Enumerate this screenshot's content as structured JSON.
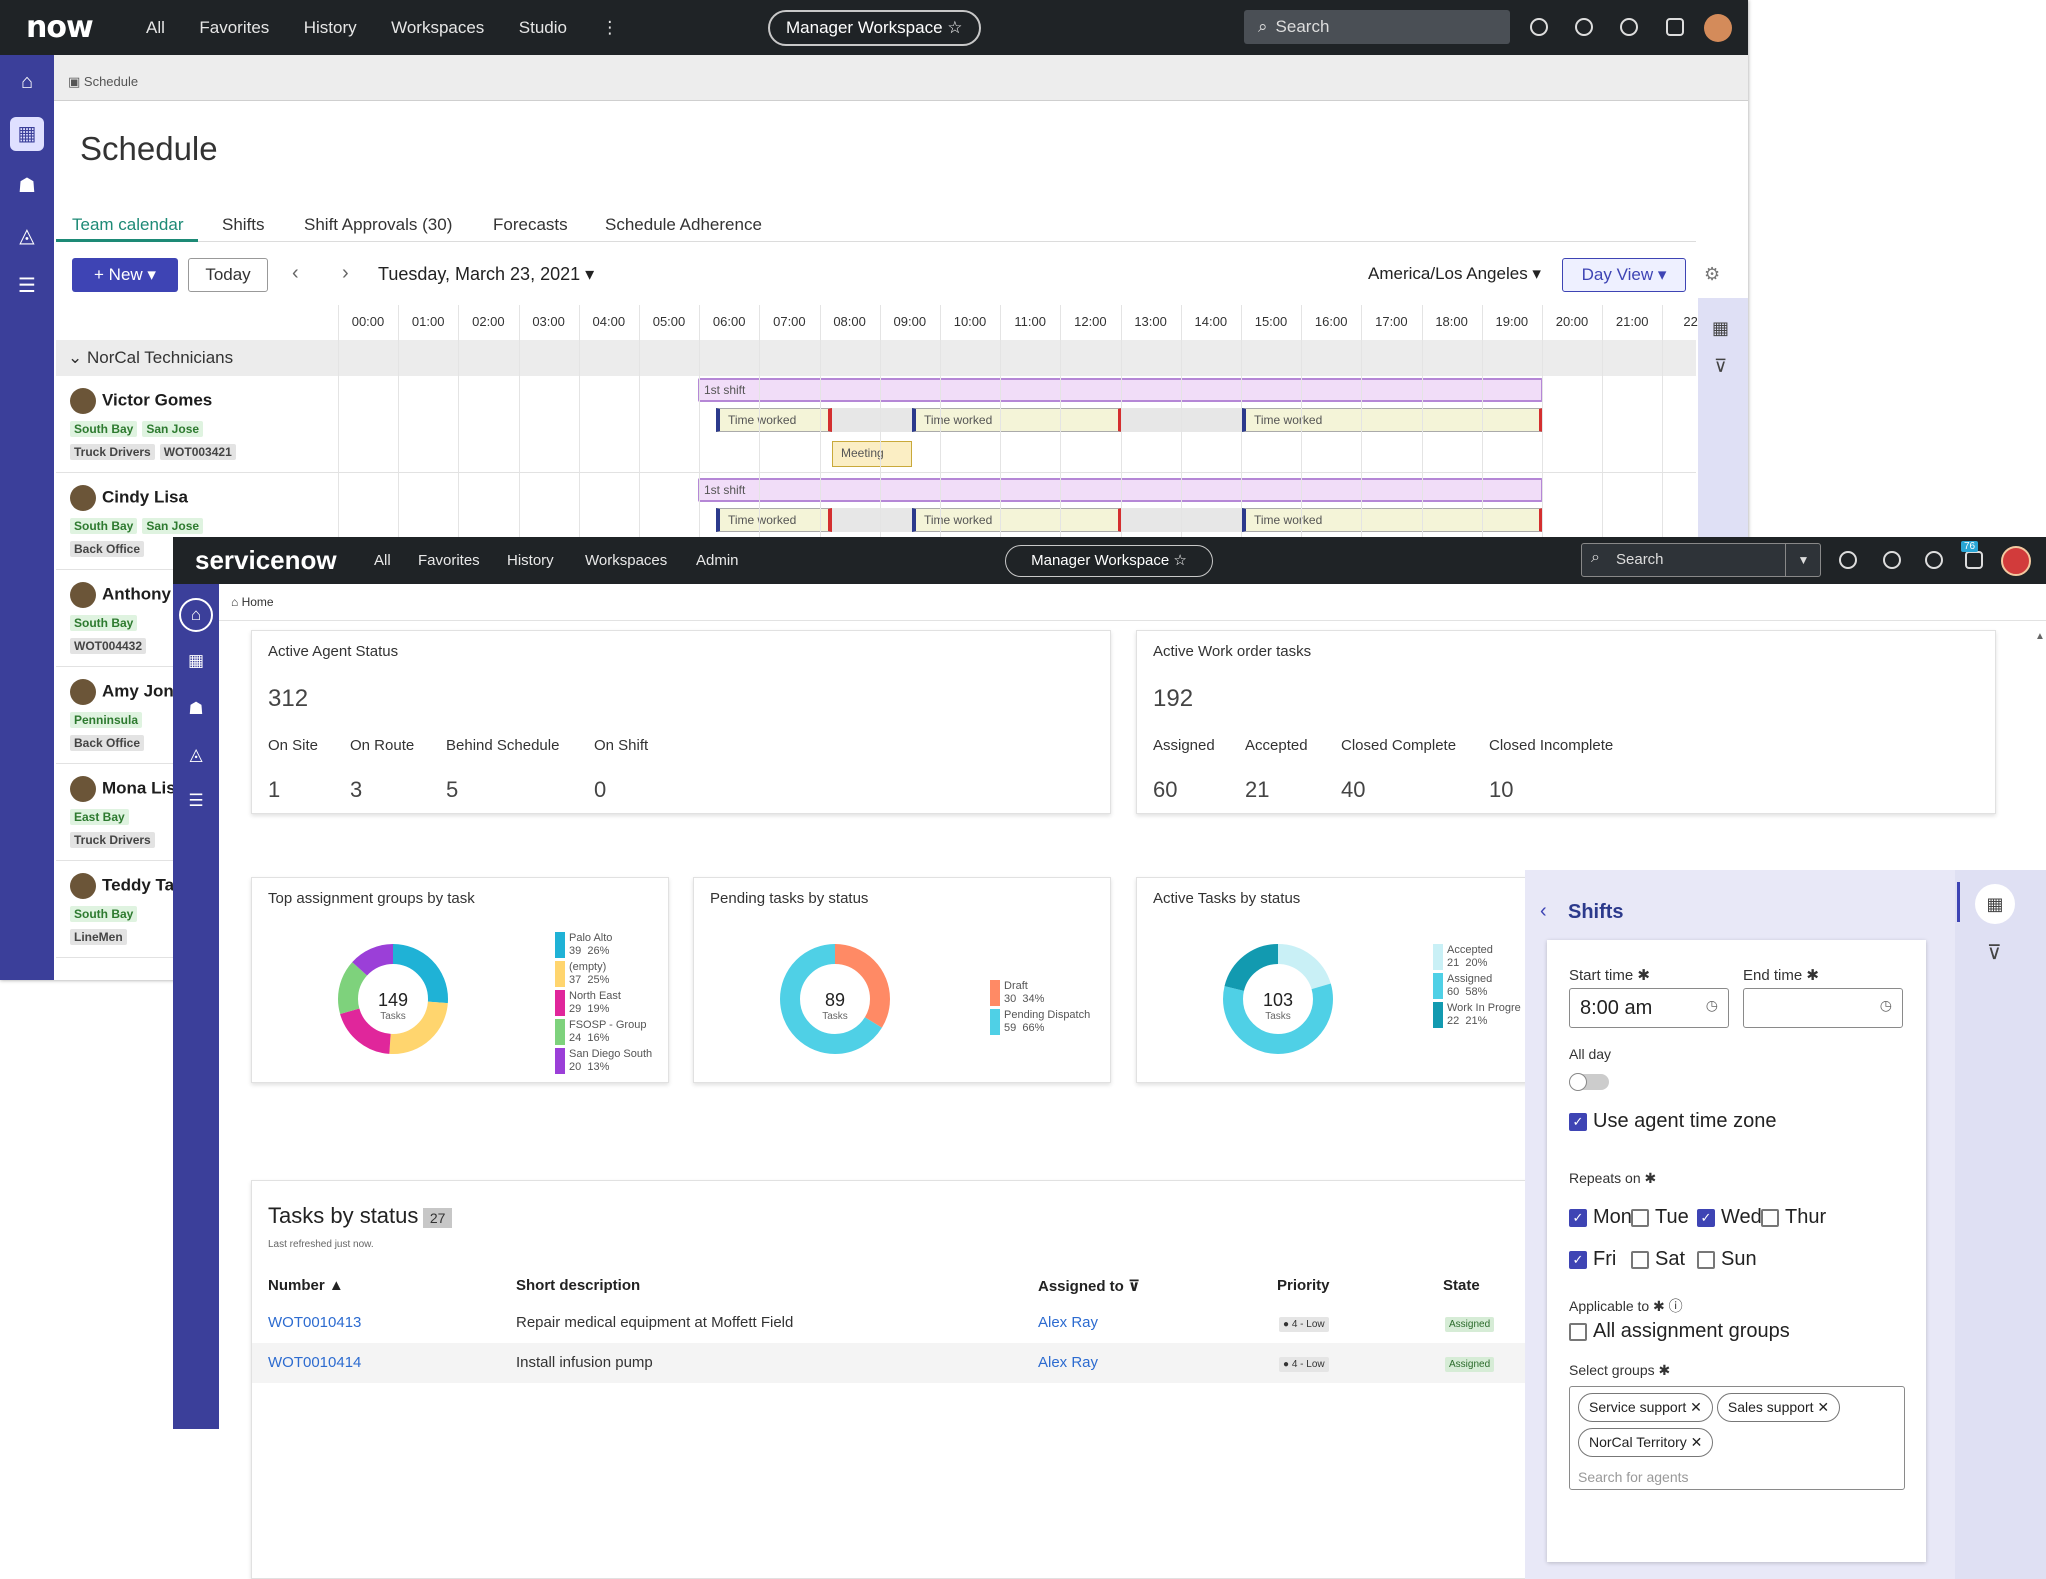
{
  "schedule_window": {
    "logo": "now",
    "nav": [
      "All",
      "Favorites",
      "History",
      "Workspaces",
      "Studio"
    ],
    "workspace_pill": "Manager Workspace ☆",
    "search_placeholder": "Search",
    "breadcrumb": "Schedule",
    "page_title": "Schedule",
    "tabs": [
      "Team calendar",
      "Shifts",
      "Shift Approvals (30)",
      "Forecasts",
      "Schedule Adherence"
    ],
    "new_button": "+ New ▾",
    "today_button": "Today",
    "date": "Tuesday, March 23, 2021 ▾",
    "timezone": "America/Los Angeles ▾",
    "view_button": "Day View ▾",
    "hours": [
      "00:00",
      "01:00",
      "02:00",
      "03:00",
      "04:00",
      "05:00",
      "06:00",
      "07:00",
      "08:00",
      "09:00",
      "10:00",
      "11:00",
      "12:00",
      "13:00",
      "14:00",
      "15:00",
      "16:00",
      "17:00",
      "18:00",
      "19:00",
      "20:00",
      "21:00",
      "22:"
    ],
    "group": "NorCal Technicians",
    "people": [
      {
        "name": "Victor Gomes",
        "tags_green": [
          "South Bay",
          "San Jose"
        ],
        "tags_gray": [
          "Truck Drivers",
          "WOT003421"
        ]
      },
      {
        "name": "Cindy Lisa",
        "tags_green": [
          "South Bay",
          "San Jose"
        ],
        "tags_gray": [
          "Back Office"
        ]
      },
      {
        "name": "Anthony",
        "tags_green": [
          "South Bay"
        ],
        "tags_gray": [
          "WOT004432"
        ]
      },
      {
        "name": "Amy Jone",
        "tags_green": [
          "Penninsula"
        ],
        "tags_gray": [
          "Back Office"
        ]
      },
      {
        "name": "Mona Lis",
        "tags_green": [
          "East Bay"
        ],
        "tags_gray": [
          "Truck Drivers"
        ]
      },
      {
        "name": "Teddy Ta",
        "tags_green": [
          "South Bay"
        ],
        "tags_gray": [
          "LineMen"
        ]
      }
    ],
    "shift_label": "1st shift",
    "worked_label": "Time worked",
    "meeting_label": "Meeting"
  },
  "dashboard_window": {
    "logo": "servicenow",
    "nav": [
      "All",
      "Favorites",
      "History",
      "Workspaces",
      "Admin"
    ],
    "workspace_pill": "Manager Workspace ☆",
    "search_placeholder": "Search",
    "notification_count": "76",
    "breadcrumb": "Home",
    "agent_status": {
      "title": "Active Agent Status",
      "total": "312",
      "labels": [
        "On Site",
        "On Route",
        "Behind Schedule",
        "On Shift"
      ],
      "values": [
        "1",
        "3",
        "5",
        "0"
      ]
    },
    "work_orders": {
      "title": "Active Work order tasks",
      "total": "192",
      "labels": [
        "Assigned",
        "Accepted",
        "Closed Complete",
        "Closed Incomplete"
      ],
      "values": [
        "60",
        "21",
        "40",
        "10"
      ]
    },
    "donut_top_groups": {
      "title": "Top assignment groups by task",
      "center": "149",
      "center_sub": "Tasks",
      "segments": [
        {
          "name": "Palo Alto",
          "value": 39,
          "pct": "26%",
          "color": "#1fb2d6"
        },
        {
          "name": "(empty)",
          "value": 37,
          "pct": "25%",
          "color": "#ffd56e"
        },
        {
          "name": "North East",
          "value": 29,
          "pct": "19%",
          "color": "#e0269b"
        },
        {
          "name": "FSOSP - Group",
          "value": 24,
          "pct": "16%",
          "color": "#7ed27c"
        },
        {
          "name": "San Diego South",
          "value": 20,
          "pct": "13%",
          "color": "#9b3fd8"
        }
      ]
    },
    "donut_pending": {
      "title": "Pending tasks by status",
      "center": "89",
      "center_sub": "Tasks",
      "segments": [
        {
          "name": "Draft",
          "value": 30,
          "pct": "34%",
          "color": "#ff8a65"
        },
        {
          "name": "Pending Dispatch",
          "value": 59,
          "pct": "66%",
          "color": "#4fd0e6"
        }
      ]
    },
    "donut_active": {
      "title": "Active Tasks by status",
      "center": "103",
      "center_sub": "Tasks",
      "segments": [
        {
          "name": "Accepted",
          "value": 21,
          "pct": "20%",
          "color": "#c9f0f6"
        },
        {
          "name": "Assigned",
          "value": 60,
          "pct": "58%",
          "color": "#4fd0e6"
        },
        {
          "name": "Work In Progre",
          "value": 22,
          "pct": "21%",
          "color": "#129ab0"
        }
      ]
    },
    "tasks_table": {
      "title": "Tasks by status",
      "count": "27",
      "refreshed": "Last refreshed just now.",
      "headers": [
        "Number ▲",
        "Short description",
        "Assigned to ⊽",
        "Priority",
        "State"
      ],
      "rows": [
        {
          "number": "WOT0010413",
          "desc": "Repair medical equipment at Moffett Field",
          "assigned": "Alex Ray",
          "priority": "● 4 - Low",
          "state": "Assigned"
        },
        {
          "number": "WOT0010414",
          "desc": "Install infusion pump",
          "assigned": "Alex Ray",
          "priority": "● 4 - Low",
          "state": "Assigned"
        }
      ]
    }
  },
  "shifts_panel": {
    "title": "Shifts",
    "start_label": "Start time ✱",
    "start_value": "8:00 am",
    "end_label": "End time ✱",
    "allday_label": "All day",
    "agent_tz_label": "Use agent time zone",
    "repeats_label": "Repeats on ✱",
    "days": [
      {
        "label": "Mon",
        "checked": true
      },
      {
        "label": "Tue",
        "checked": false
      },
      {
        "label": "Wed",
        "checked": true
      },
      {
        "label": "Thur",
        "checked": false
      },
      {
        "label": "Fri",
        "checked": true
      },
      {
        "label": "Sat",
        "checked": false
      },
      {
        "label": "Sun",
        "checked": false
      }
    ],
    "applicable_label": "Applicable to ✱ ⓘ",
    "all_groups_label": "All assignment groups",
    "select_groups_label": "Select groups ✱",
    "chips": [
      "Service support ✕",
      "Sales support ✕",
      "NorCal Territory ✕"
    ],
    "search_agents_placeholder": "Search for agents"
  }
}
